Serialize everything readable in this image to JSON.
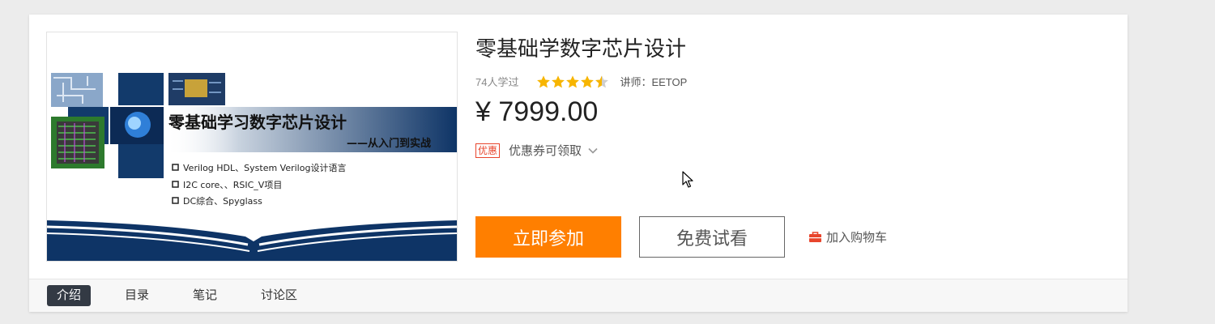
{
  "course": {
    "title": "零基础学数字芯片设计",
    "learners": "74人学过",
    "rating": 4.5,
    "teacher": "讲师：EETOP",
    "price": "¥ 7999.00"
  },
  "thumbnail": {
    "heading": "零基础学习数字芯片设计",
    "subheading": "——从入门到实战",
    "bullets": [
      "Verilog HDL、System Verilog设计语言",
      "I2C core、、RSIC_V项目",
      "DC综合、Spyglass"
    ]
  },
  "coupon": {
    "badge": "优惠",
    "label": "优惠券可领取"
  },
  "actions": {
    "join_label": "立即参加",
    "trial_label": "免费试看",
    "cart_label": "加入购物车"
  },
  "tabs": [
    {
      "label": "介绍",
      "active": true
    },
    {
      "label": "目录",
      "active": false
    },
    {
      "label": "笔记",
      "active": false
    },
    {
      "label": "讨论区",
      "active": false
    }
  ],
  "colors": {
    "accent_orange": "#ff7f00",
    "star_yellow": "#f7b500",
    "coupon_red": "#e8452c",
    "navy": "#0e3466",
    "active_tab": "#333a44"
  }
}
